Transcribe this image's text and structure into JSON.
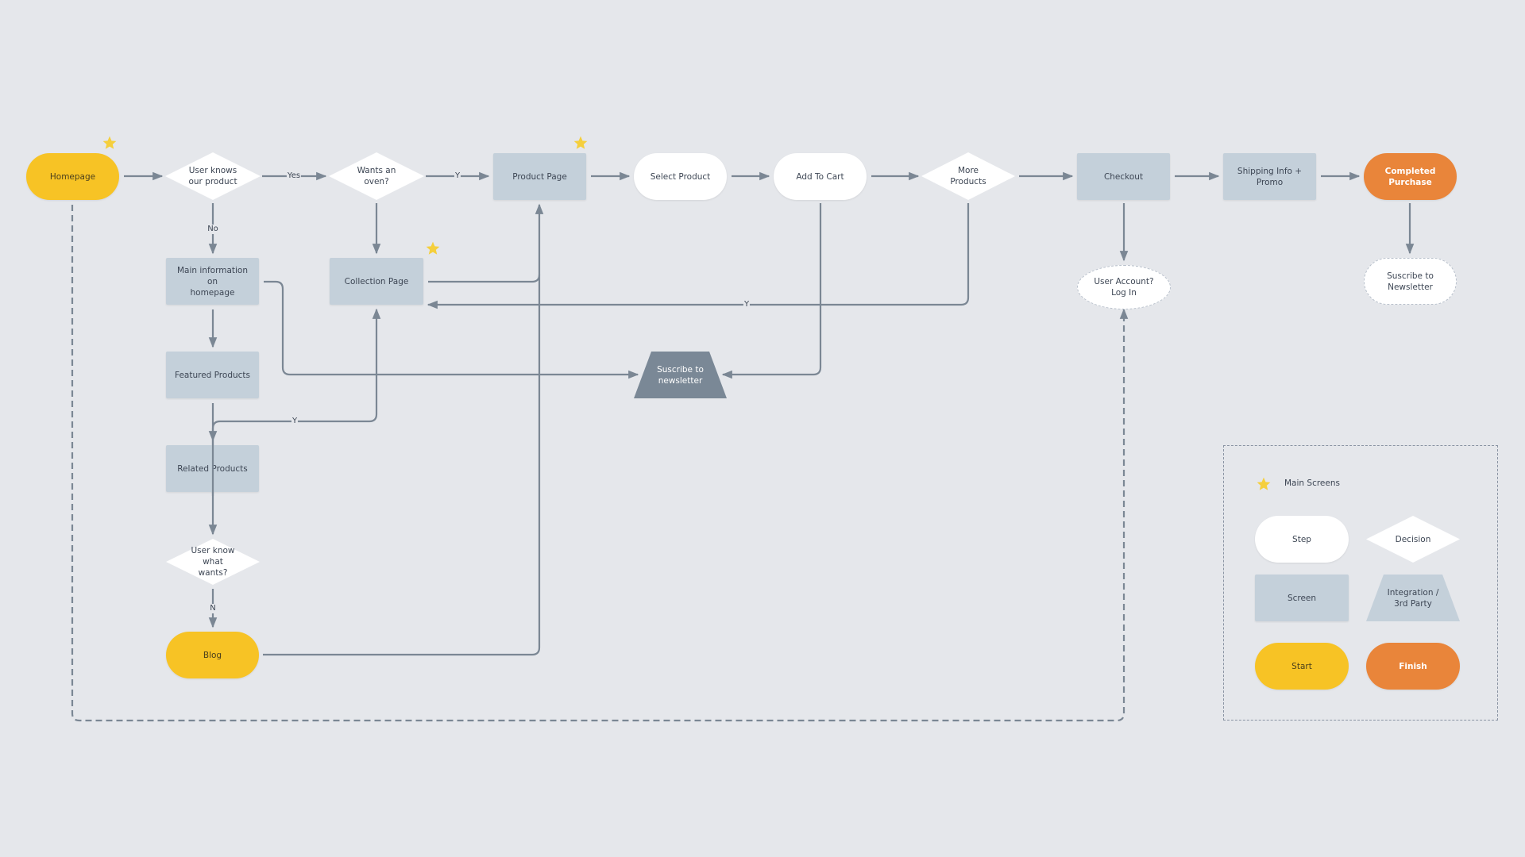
{
  "colors": {
    "background": "#e5e7eb",
    "screen": "#c4d0da",
    "step": "#ffffff",
    "start": "#f7c325",
    "finish": "#e9853a",
    "integration": "#7a8896",
    "connector": "#7b8794",
    "star": "#f5cf3c"
  },
  "nodes": {
    "homepage": "Homepage",
    "user_knows_product": "User knows our product",
    "wants_oven": "Wants an oven?",
    "product_page": "Product Page",
    "select_product": "Select Product",
    "add_to_cart": "Add To Cart",
    "more_products": "More Products",
    "checkout": "Checkout",
    "shipping_info": [
      "Shipping Info +",
      "Promo"
    ],
    "completed_purchase": "Completed Purchase",
    "main_info": [
      "Main information on",
      "homepage"
    ],
    "collection_page": "Collection Page",
    "featured_products": "Featured Products",
    "related_products": "Related Products",
    "user_know_wants": [
      "User know what",
      "wants?"
    ],
    "blog": "Blog",
    "subscribe_integration": [
      "Suscribe to",
      "newsletter"
    ],
    "user_account": [
      "User Account?",
      "Log In"
    ],
    "subscribe_newsletter_step": [
      "Suscribe to",
      "Newsletter"
    ]
  },
  "edge_labels": {
    "yes": "Yes",
    "no": "No",
    "y_oven": "Y",
    "y_more": "Y",
    "y_related": "Y",
    "n_blog": "N"
  },
  "legend": {
    "main_screens": "Main Screens",
    "step": "Step",
    "decision": "Decision",
    "screen": "Screen",
    "integration": [
      "Integration /",
      "3rd Party"
    ],
    "start": "Start",
    "finish": "Finish"
  }
}
